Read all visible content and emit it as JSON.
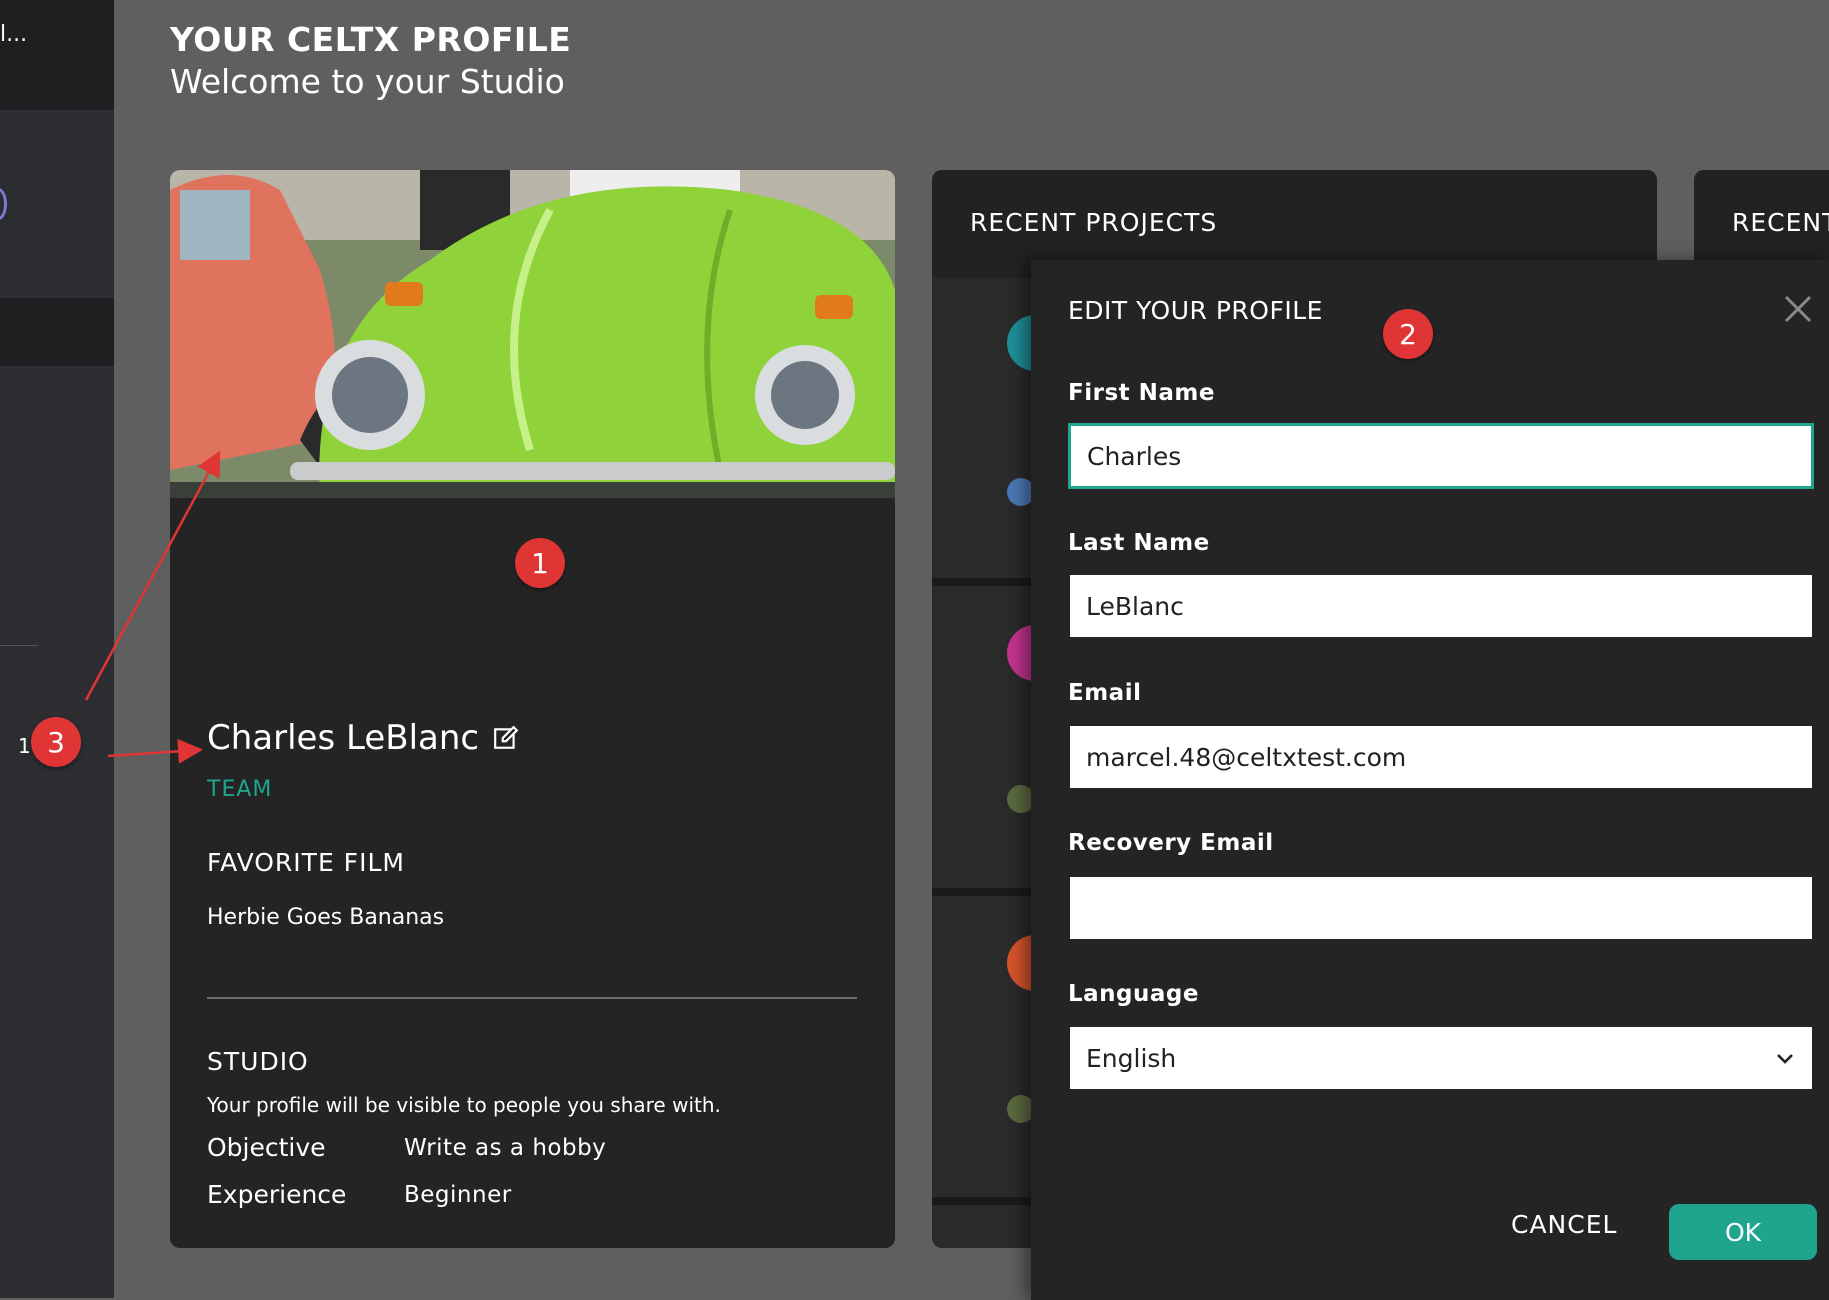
{
  "sidebar": {
    "top_text": "l...",
    "number_fragment": "1"
  },
  "header": {
    "title": "YOUR CELTX PROFILE",
    "subtitle": "Welcome to your Studio"
  },
  "profile": {
    "name": "Charles LeBlanc",
    "plan": "TEAM",
    "favorite_film_title": "FAVORITE FILM",
    "favorite_film": "Herbie Goes Bananas",
    "studio_title": "STUDIO",
    "objective_label": "Objective",
    "objective_value": "Write as a hobby",
    "experience_label": "Experience",
    "experience_value": "Beginner",
    "note": "Your profile will be visible to people you share with."
  },
  "recent_projects": {
    "title": "RECENT PROJECTS"
  },
  "third_panel": {
    "title": "RECENT"
  },
  "modal": {
    "title": "EDIT YOUR PROFILE",
    "first_name_label": "First Name",
    "first_name_value": "Charles",
    "last_name_label": "Last Name",
    "last_name_value": "LeBlanc",
    "email_label": "Email",
    "email_value": "marcel.48@celtxtest.com",
    "recovery_label": "Recovery Email",
    "recovery_value": "",
    "language_label": "Language",
    "language_value": "English",
    "cancel_label": "CANCEL",
    "ok_label": "OK"
  },
  "annotations": {
    "badge1": "1",
    "badge2": "2",
    "badge3": "3"
  },
  "colors": {
    "accent": "#1fa58e",
    "callout": "#e03535",
    "panel": "#242424",
    "backdrop": "#5f5f5f"
  },
  "icons": [
    "edit-icon",
    "close-icon",
    "chevron-down-icon"
  ]
}
